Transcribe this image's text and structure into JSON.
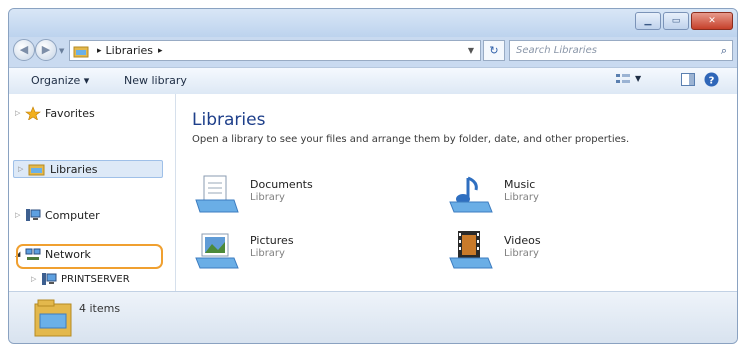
{
  "address": {
    "crumb_label": "Libraries",
    "separator": "▸"
  },
  "search": {
    "placeholder": "Search Libraries"
  },
  "toolbar": {
    "organize_label": "Organize ▾",
    "new_library_label": "New library"
  },
  "nav": {
    "items": [
      {
        "label": "Favorites"
      },
      {
        "label": "Libraries"
      },
      {
        "label": "Computer"
      },
      {
        "label": "Network"
      },
      {
        "label": "PRINTSERVER"
      }
    ]
  },
  "content": {
    "title": "Libraries",
    "description": "Open a library to see your files and arrange them by folder, date, and other properties.",
    "libraries": [
      {
        "name": "Documents",
        "type": "Library"
      },
      {
        "name": "Music",
        "type": "Library"
      },
      {
        "name": "Pictures",
        "type": "Library"
      },
      {
        "name": "Videos",
        "type": "Library"
      }
    ]
  },
  "status": {
    "count_text": "4 items"
  },
  "colors": {
    "highlight": "#f0a030",
    "title_blue": "#1e3f8a"
  }
}
